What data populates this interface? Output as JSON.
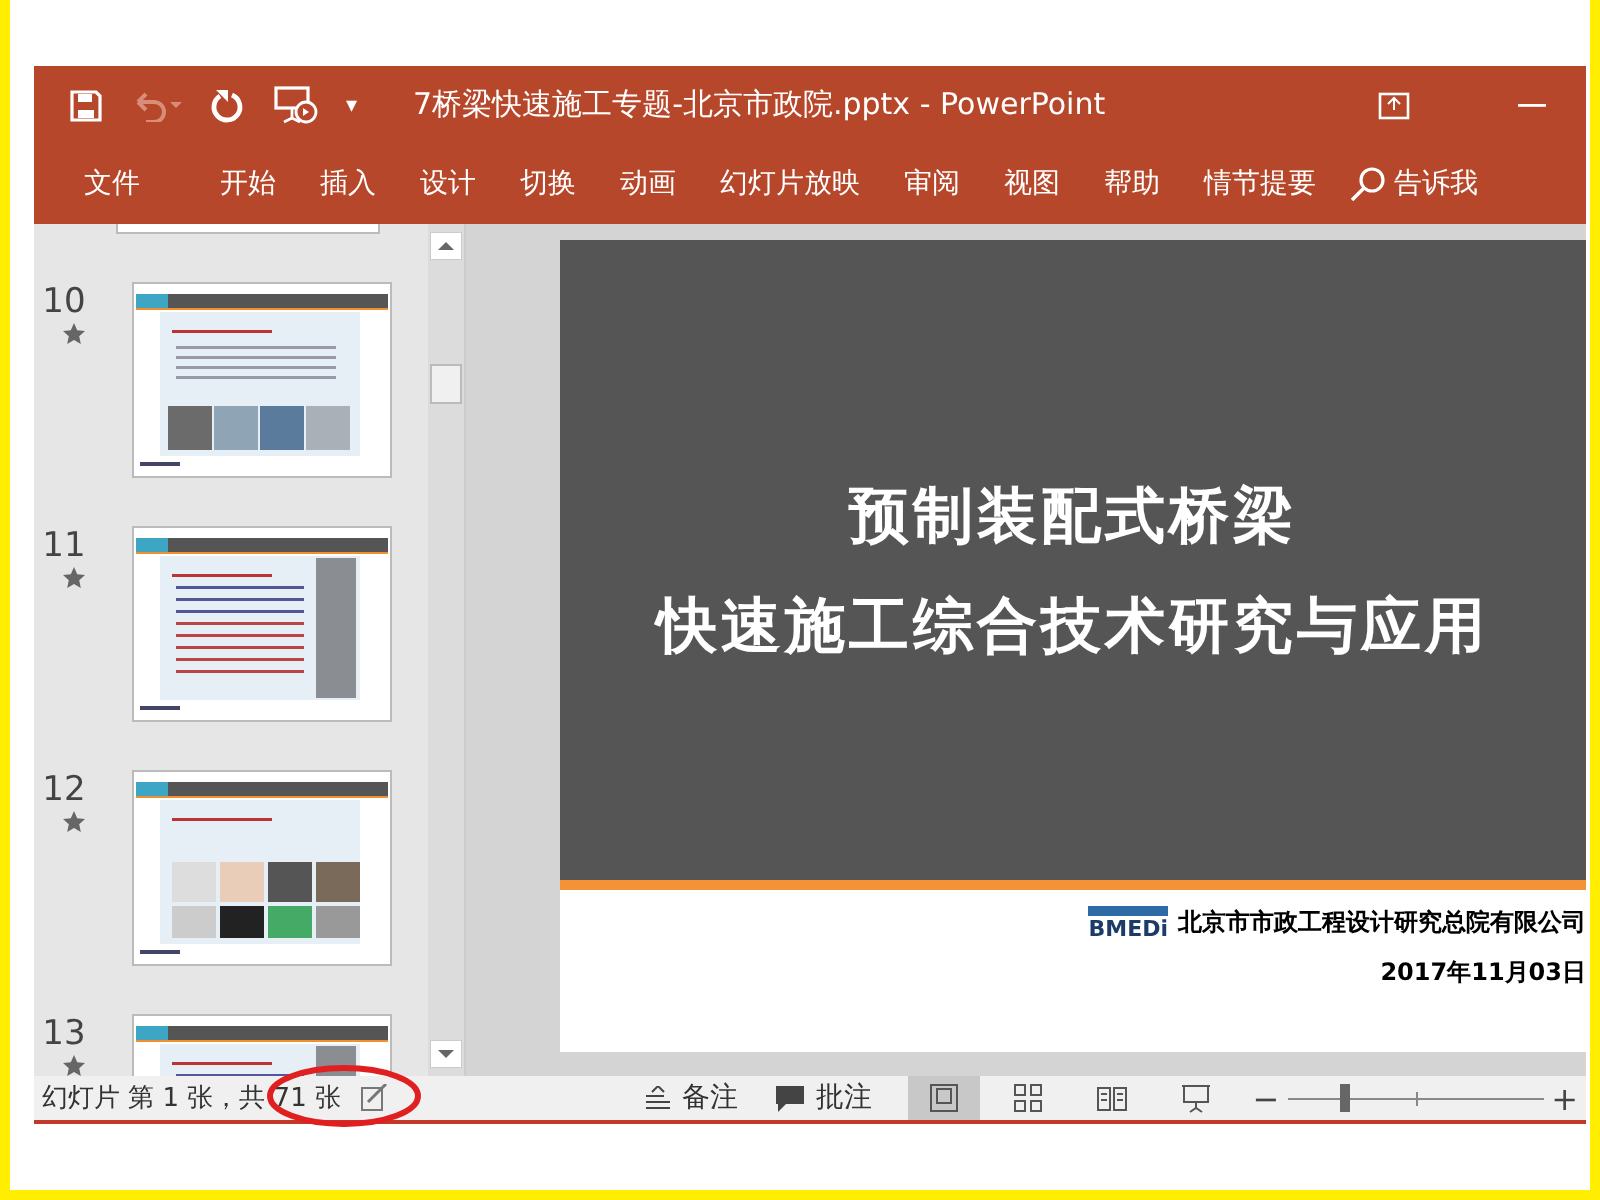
{
  "window": {
    "title": "7桥梁快速施工专题-北京市政院.pptx  -  PowerPoint",
    "quick_access": [
      {
        "kind": "save",
        "disabled": false
      },
      {
        "kind": "undo",
        "disabled": true
      },
      {
        "kind": "redo",
        "disabled": false
      },
      {
        "kind": "present",
        "disabled": false
      }
    ],
    "customize": "▾"
  },
  "ribbon": {
    "tabs": [
      {
        "label": "文件"
      },
      {
        "label": "开始"
      },
      {
        "label": "插入"
      },
      {
        "label": "设计"
      },
      {
        "label": "切换"
      },
      {
        "label": "动画"
      },
      {
        "label": "幻灯片放映"
      },
      {
        "label": "审阅"
      },
      {
        "label": "视图"
      },
      {
        "label": "帮助"
      },
      {
        "label": "情节提要"
      }
    ],
    "search": "告诉我"
  },
  "thumbnails": [
    {
      "number": "10",
      "kind": "photos"
    },
    {
      "number": "11",
      "kind": "text"
    },
    {
      "number": "12",
      "kind": "grid"
    },
    {
      "number": "13",
      "kind": "text"
    }
  ],
  "slide": {
    "title_lines": [
      "预制装配式桥梁",
      "快速施工综合技术研究与应用"
    ],
    "logo_text": "BMEDi",
    "organization": "北京市市政工程设计研究总院有限公司",
    "date": "2017年11月03日"
  },
  "status_bar": {
    "slide_info": "幻灯片 第 1 张，共 71 张",
    "notes": "备注",
    "comments": "批注",
    "views": [
      {
        "kind": "normal",
        "selected": true
      },
      {
        "kind": "sorter",
        "selected": false
      },
      {
        "kind": "reading",
        "selected": false
      },
      {
        "kind": "slideshow",
        "selected": false
      }
    ],
    "zoom": {
      "minus": "−",
      "plus": "+",
      "level": 0.22
    }
  },
  "annotation": {
    "kind": "ellipse",
    "color": "#e02020"
  }
}
